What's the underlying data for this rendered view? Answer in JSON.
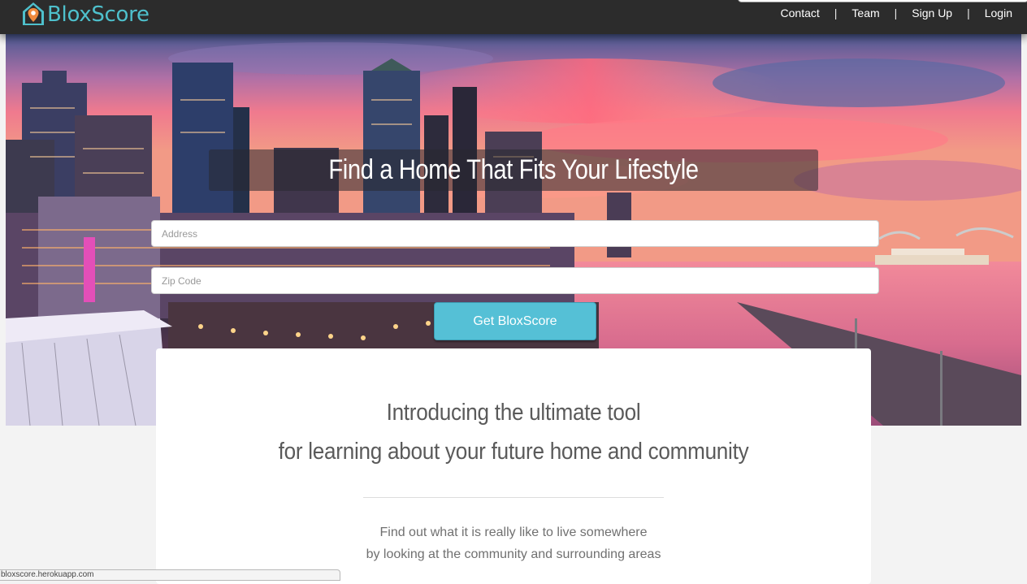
{
  "brand": {
    "name": "BloxScore",
    "color": "#4ec0cc",
    "icon": "house-pin-icon"
  },
  "nav": {
    "links": [
      "Contact",
      "Team",
      "Sign Up",
      "Login"
    ],
    "separator": "|"
  },
  "hero": {
    "headline": "Find a Home That Fits Your Lifestyle",
    "address_placeholder": "Address",
    "zip_placeholder": "Zip Code",
    "cta_label": "Get BloxScore",
    "cta_color": "#55c0d6"
  },
  "intro": {
    "line1": "Introducing the ultimate tool",
    "line2": "for learning about your future home and community",
    "sub1": "Find out what it is really like to live somewhere",
    "sub2": "by looking at the community and surrounding areas"
  },
  "status_bar": {
    "text": "bloxscore.herokuapp.com"
  }
}
